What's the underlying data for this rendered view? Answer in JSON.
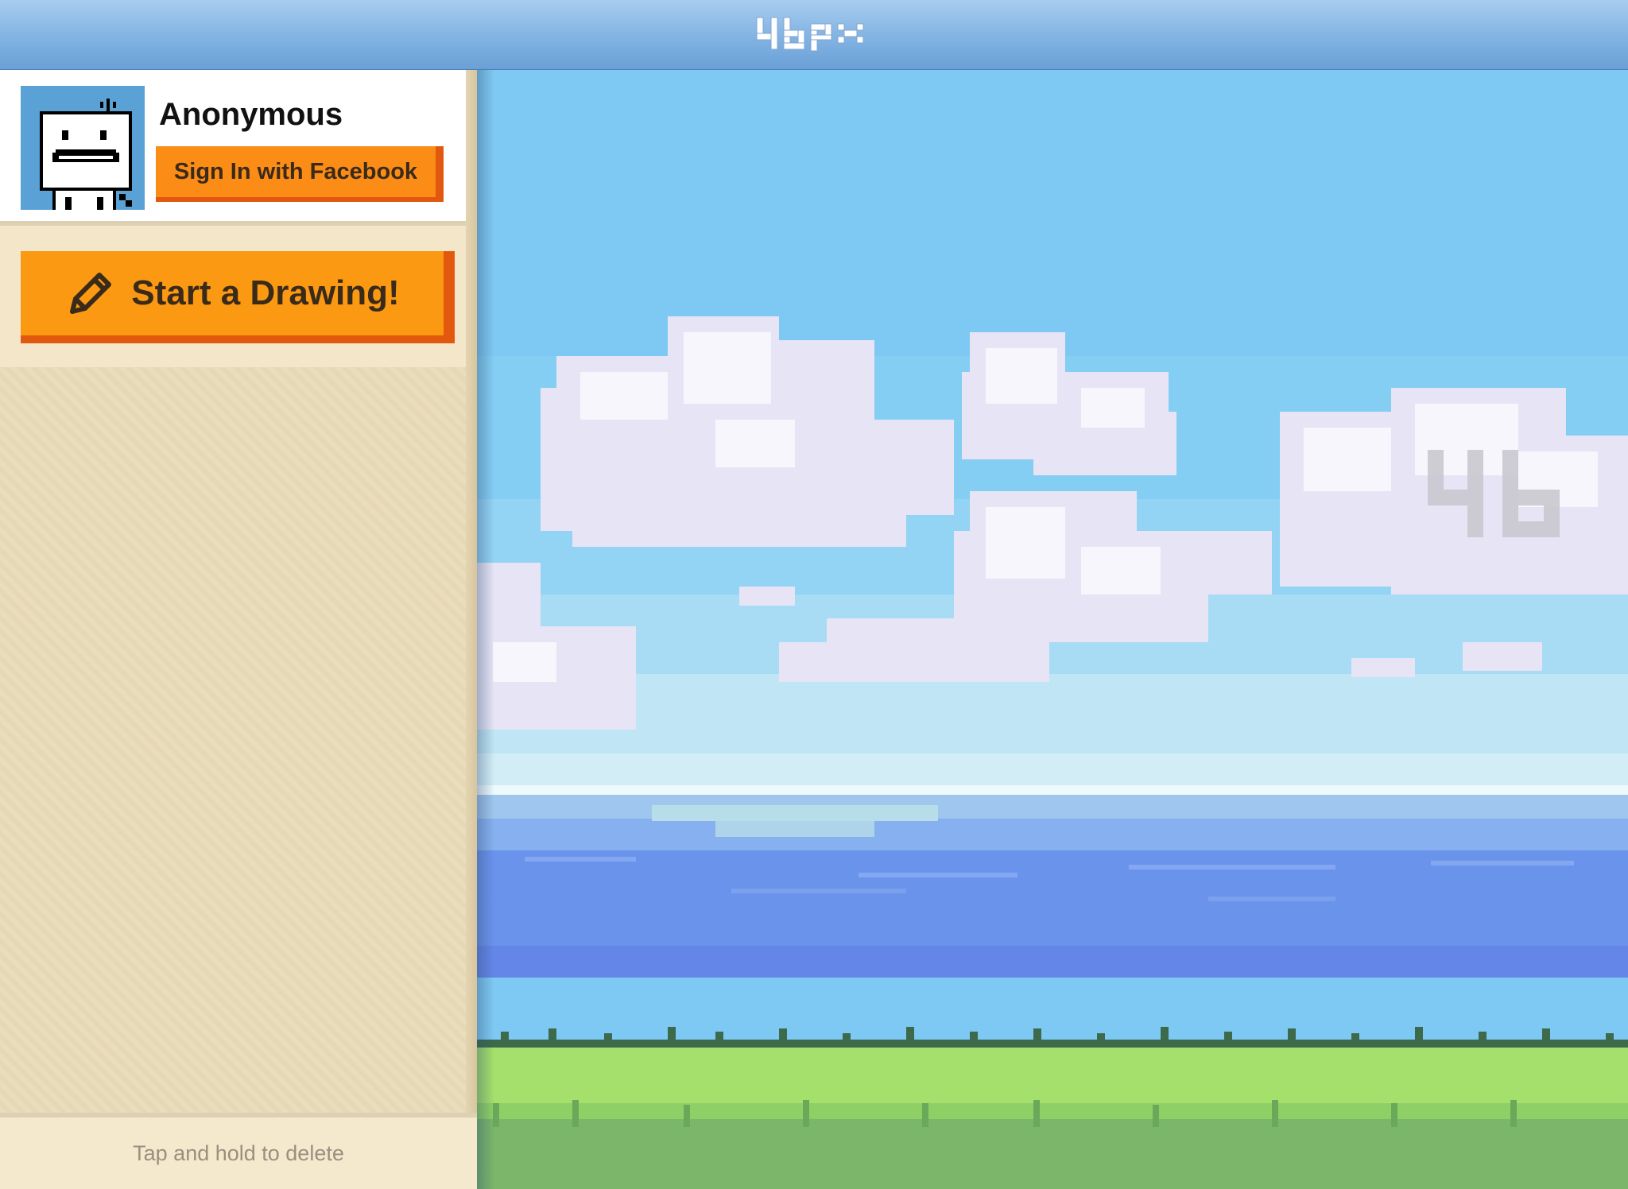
{
  "app": {
    "logo_text": "46px"
  },
  "profile": {
    "username": "Anonymous",
    "sign_in_label": "Sign In with Facebook",
    "avatar": "pixel-robot-avatar"
  },
  "actions": {
    "start_drawing_label": "Start a Drawing!",
    "start_drawing_icon": "pencil-icon"
  },
  "drawings": {
    "items": [],
    "footer_hint": "Tap and hold to delete"
  },
  "canvas": {
    "scene": "pixel-art sky, clouds, sea and grass",
    "watermark_text": "46"
  },
  "colors": {
    "topbar": "#84b5e4",
    "accent_orange": "#fb9a12",
    "accent_orange_dark": "#e2580f",
    "sidebar_bg": "#eddfc0",
    "sky": "#7ec9f3",
    "sea": "#6a93ec",
    "grass": "#a4e06b"
  }
}
